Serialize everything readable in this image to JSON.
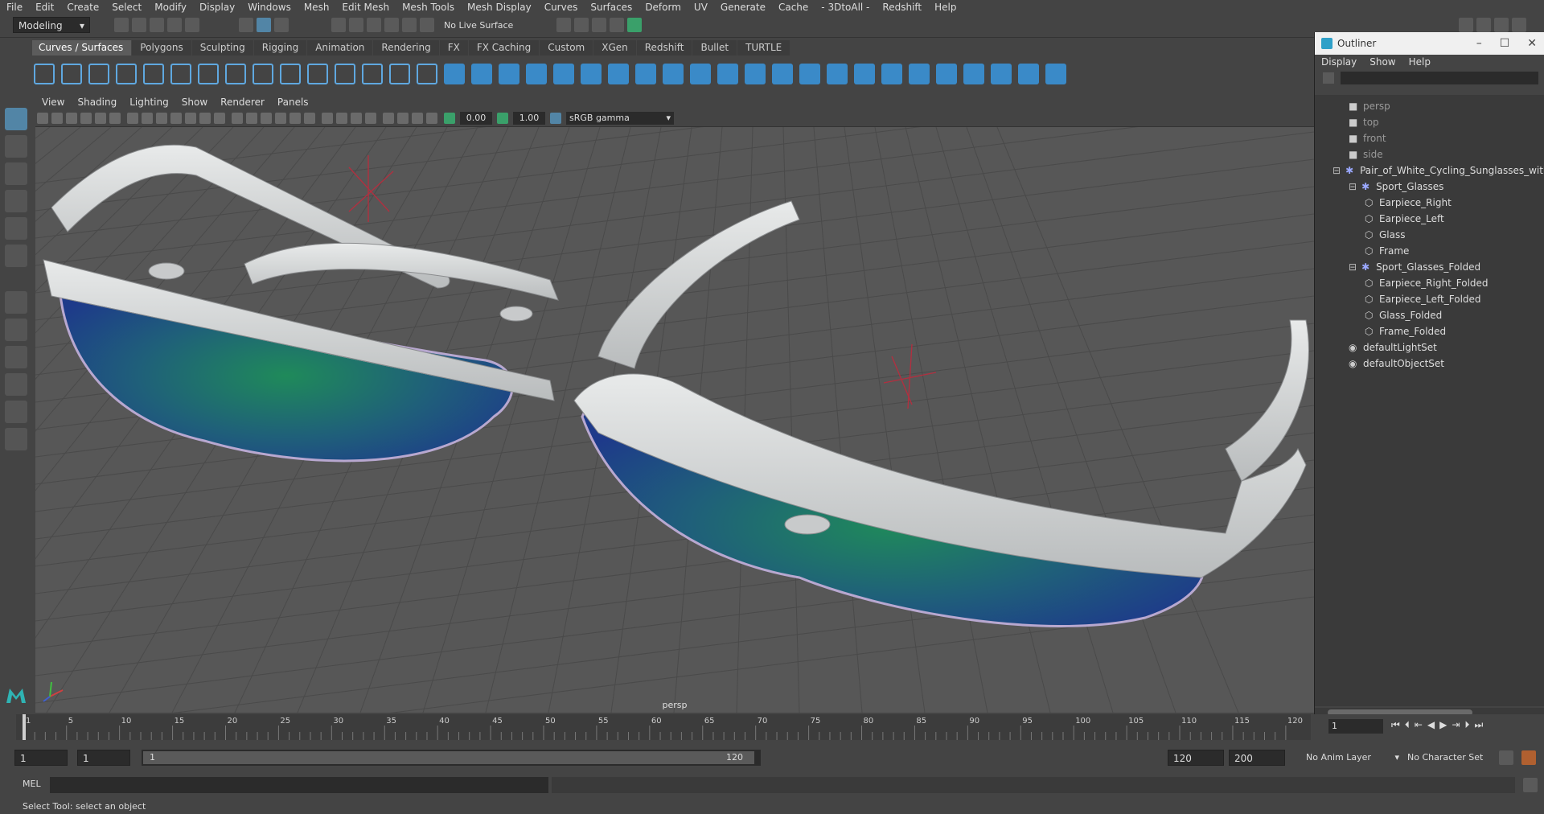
{
  "menu": [
    "File",
    "Edit",
    "Create",
    "Select",
    "Modify",
    "Display",
    "Windows",
    "Mesh",
    "Edit Mesh",
    "Mesh Tools",
    "Mesh Display",
    "Curves",
    "Surfaces",
    "Deform",
    "UV",
    "Generate",
    "Cache",
    "- 3DtoAll -",
    "Redshift",
    "Help"
  ],
  "status": {
    "mode": "Modeling",
    "live_surface": "No Live Surface"
  },
  "shelf_tabs": [
    "Curves / Surfaces",
    "Polygons",
    "Sculpting",
    "Rigging",
    "Animation",
    "Rendering",
    "FX",
    "FX Caching",
    "Custom",
    "XGen",
    "Redshift",
    "Bullet",
    "TURTLE"
  ],
  "shelf_active": 0,
  "viewport": {
    "menu": [
      "View",
      "Shading",
      "Lighting",
      "Show",
      "Renderer",
      "Panels"
    ],
    "exposure": "0.00",
    "gamma": "1.00",
    "colorspace": "sRGB gamma",
    "camera_label": "persp"
  },
  "outliner": {
    "title": "Outliner",
    "menu": [
      "Display",
      "Show",
      "Help"
    ],
    "items": [
      {
        "label": "persp",
        "level": 0,
        "kind": "camera",
        "dim": true
      },
      {
        "label": "top",
        "level": 0,
        "kind": "camera",
        "dim": true
      },
      {
        "label": "front",
        "level": 0,
        "kind": "camera",
        "dim": true
      },
      {
        "label": "side",
        "level": 0,
        "kind": "camera",
        "dim": true
      },
      {
        "label": "Pair_of_White_Cycling_Sunglasses_with_Blu",
        "level": 0,
        "kind": "group",
        "dim": false
      },
      {
        "label": "Sport_Glasses",
        "level": 1,
        "kind": "group",
        "dim": false
      },
      {
        "label": "Earpiece_Right",
        "level": 2,
        "kind": "mesh",
        "dim": false
      },
      {
        "label": "Earpiece_Left",
        "level": 2,
        "kind": "mesh",
        "dim": false
      },
      {
        "label": "Glass",
        "level": 2,
        "kind": "mesh",
        "dim": false
      },
      {
        "label": "Frame",
        "level": 2,
        "kind": "mesh",
        "dim": false
      },
      {
        "label": "Sport_Glasses_Folded",
        "level": 1,
        "kind": "group",
        "dim": false
      },
      {
        "label": "Earpiece_Right_Folded",
        "level": 2,
        "kind": "mesh",
        "dim": false
      },
      {
        "label": "Earpiece_Left_Folded",
        "level": 2,
        "kind": "mesh",
        "dim": false
      },
      {
        "label": "Glass_Folded",
        "level": 2,
        "kind": "mesh",
        "dim": false
      },
      {
        "label": "Frame_Folded",
        "level": 2,
        "kind": "mesh",
        "dim": false
      },
      {
        "label": "defaultLightSet",
        "level": 0,
        "kind": "set",
        "dim": false
      },
      {
        "label": "defaultObjectSet",
        "level": 0,
        "kind": "set",
        "dim": false
      }
    ]
  },
  "timeline": {
    "ticks": [
      "1",
      "5",
      "10",
      "15",
      "20",
      "25",
      "30",
      "35",
      "40",
      "45",
      "50",
      "55",
      "60",
      "65",
      "70",
      "75",
      "80",
      "85",
      "90",
      "95",
      "100",
      "105",
      "110",
      "115",
      "120"
    ],
    "current_frame": "1"
  },
  "range": {
    "start": "1",
    "anim_start": "1",
    "slider_start": "1",
    "slider_end": "120",
    "end": "120",
    "anim_end": "200",
    "anim_layer": "No Anim Layer",
    "char_set": "No Character Set"
  },
  "cmd": {
    "label": "MEL"
  },
  "help_text": "Select Tool: select an object",
  "colors": {
    "accent": "#5285a6",
    "bg": "#444444",
    "viewport": "#575757",
    "lens_center": "#1f8a5a",
    "lens_edge": "#1e3a8a"
  }
}
